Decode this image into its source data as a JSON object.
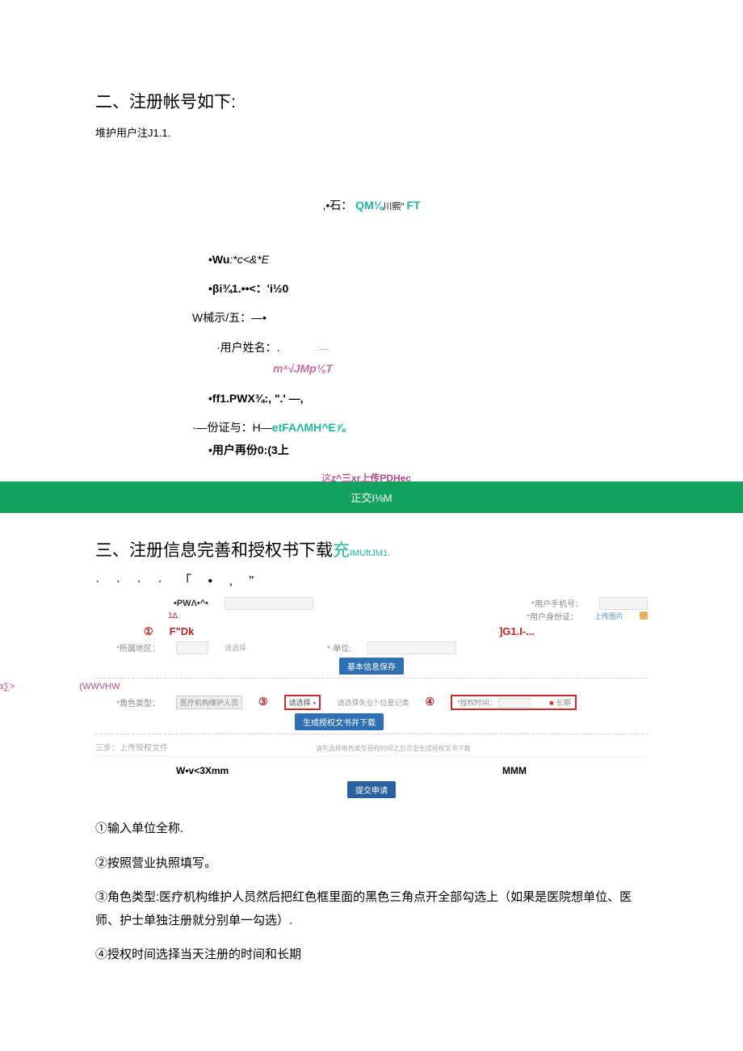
{
  "section2": {
    "title": "二、注册帐号如下:",
    "subline": "堆护用户注J1.1.",
    "line_stone_prefix": ",•石：",
    "line_stone_teal": "QM⅛",
    "line_stone_suffix": "川熙\" ",
    "line_stone_ft": "FT",
    "line_wu_prefix": "•Wu",
    "line_wu_italic": ":*c<&*E",
    "line_bi": "•βi¾1.••<：'i½0",
    "line_w_xi": "W械示/五：—•",
    "line_username_label": "·用户姓名：.",
    "line_username_asc": "∴—",
    "line_m_jmp": "mˣ√JMp⅛T",
    "line_ff1": "•ff1.PWX¾:,  \".' —,",
    "line_id_prefix": "·—份证与：H—",
    "line_id_teal": "etFAΛMH^E⅞",
    "line_user_re": "•用户再份0:(3上",
    "line_upload_prefix": "这",
    "line_upload_mid": "z^三xr上传",
    "line_upload_suffix": "PDHec",
    "submit_bar": "正交I⅛M"
  },
  "section3": {
    "title_main": "三、注册信息完善和授权书下载",
    "title_suffix_char": "充",
    "title_suffix_small": "IMUftJM1.",
    "dot_row": "· · · ·  「 • ,  \"",
    "pwa_label": "•PWΛ•^•",
    "pwa_sub": "1∆.",
    "phone_label": "*用户手机号：",
    "idcard_label": "*用户身份证：",
    "upload_btn": "上传图片",
    "callout1_prefix": "①",
    "callout1_text": "F\"Dk",
    "callout_right": "]G1.I-...",
    "region_label": "*所属地区：",
    "region_val": "请选择",
    "unit_label": "*·单位:",
    "blue_btn_save": "基本信息保存",
    "step2_left": "a∑>",
    "step2_right": "(WWVHW",
    "role_label": "*角色类型：",
    "role_value": "医疗机构维护人员",
    "circled3": "③",
    "dropdown_label": "请选择",
    "circled4_prefix": "请选择失业?·位登记类",
    "circled4": "④",
    "auth_time_label": "*授权时间：",
    "long_term": "长期",
    "blue_btn_gen": "生成授权文书并下载",
    "step3_label": "三步：上传授权文件",
    "step3_hint": "请先选择角色类型授权时间之后点击生成授权文书下载",
    "bottom_left": "W•v<3Xmm",
    "bottom_right": "MMM",
    "blue_btn_submit": "提交申请"
  },
  "instructions": {
    "p1": "①输入单位全称.",
    "p2": "②按照营业执照填写。",
    "p3": "③角色类型:医疗机构维护人员然后把红色框里面的黑色三角点开全部勾选上（如果是医院想单位、医师、护士单独注册就分别单一勾选）.",
    "p4": "④授权时间选择当天注册的时间和长期"
  }
}
